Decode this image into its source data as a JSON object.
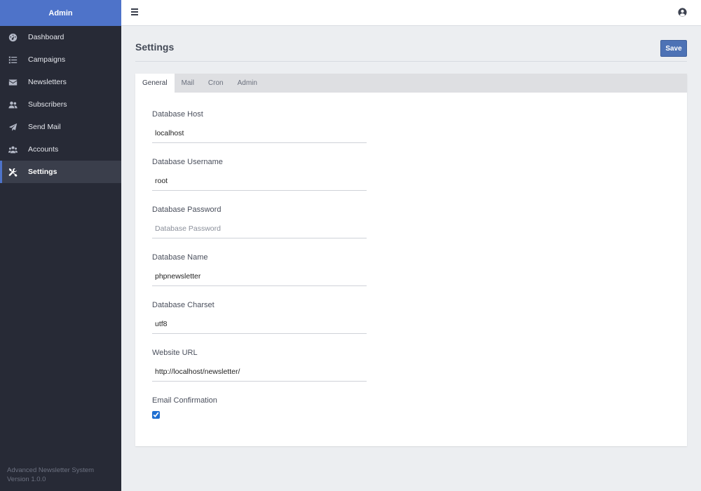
{
  "sidebar": {
    "brand": "Admin",
    "items": [
      {
        "label": "Dashboard",
        "icon": "dashboard-icon"
      },
      {
        "label": "Campaigns",
        "icon": "list-icon"
      },
      {
        "label": "Newsletters",
        "icon": "envelope-icon"
      },
      {
        "label": "Subscribers",
        "icon": "users-icon"
      },
      {
        "label": "Send Mail",
        "icon": "paper-plane-icon"
      },
      {
        "label": "Accounts",
        "icon": "user-group-icon"
      },
      {
        "label": "Settings",
        "icon": "tools-icon",
        "active": true
      }
    ],
    "footer_line1": "Advanced Newsletter System",
    "footer_line2": "Version 1.0.0"
  },
  "topbar": {
    "menu_icon": "hamburger-icon",
    "user_icon": "user-circle-icon"
  },
  "page": {
    "title": "Settings",
    "save_label": "Save"
  },
  "tabs": [
    {
      "label": "General",
      "active": true
    },
    {
      "label": "Mail"
    },
    {
      "label": "Cron"
    },
    {
      "label": "Admin"
    }
  ],
  "form": {
    "db_host": {
      "label": "Database Host",
      "value": "localhost"
    },
    "db_username": {
      "label": "Database Username",
      "value": "root"
    },
    "db_password": {
      "label": "Database Password",
      "value": "",
      "placeholder": "Database Password"
    },
    "db_name": {
      "label": "Database Name",
      "value": "phpnewsletter"
    },
    "db_charset": {
      "label": "Database Charset",
      "value": "utf8"
    },
    "website_url": {
      "label": "Website URL",
      "value": "http://localhost/newsletter/"
    },
    "email_confirmation": {
      "label": "Email Confirmation",
      "checked": true
    }
  },
  "colors": {
    "accent": "#4e73c9",
    "sidebar_bg": "#272a36",
    "save_button": "#4d72b5"
  }
}
